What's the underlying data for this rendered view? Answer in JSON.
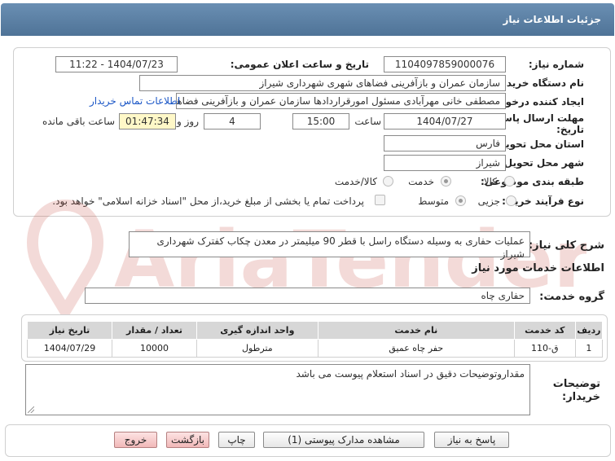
{
  "window": {
    "title": "جزئیات اطلاعات نیاز"
  },
  "need_number": {
    "label": "شماره نیاز:",
    "value": "1104097859000076"
  },
  "announce_date": {
    "label": "تاریخ و ساعت اعلان عمومی:",
    "value": "1404/07/23 - 11:22"
  },
  "buyer_org": {
    "label": "نام دستگاه خریدار:",
    "value": "سازمان عمران و بازآفرینی فضاهای شهری شهرداری شیراز"
  },
  "requester": {
    "label": "ایجاد کننده درخواست:",
    "value": "مصطفی خانی مهرآبادی مسئول امورقراردادها سازمان عمران و بازآفرینی فضاهای",
    "contact_link": "اطلاعات تماس خریدار"
  },
  "deadline": {
    "label_line1": "مهلت ارسال پاسخ: تا",
    "label_line2": "تاریخ:",
    "date": "1404/07/27",
    "time_label": "ساعت",
    "time": "15:00",
    "days": "4",
    "days_label": "روز و",
    "remaining": "01:47:34",
    "remaining_label": "ساعت باقی مانده"
  },
  "province": {
    "label": "استان محل تحویل:",
    "value": "فارس"
  },
  "city": {
    "label": "شهر محل تحویل:",
    "value": "شیراز"
  },
  "category": {
    "label": "طبقه بندی موضوعی:",
    "options": [
      "کالا",
      "خدمت",
      "کالا/خدمت"
    ],
    "selected": "خدمت"
  },
  "purchase_type": {
    "label": "نوع فرآیند خرید :",
    "options": [
      "جزیی",
      "متوسط"
    ],
    "selected": "متوسط",
    "payment_note": "پرداخت تمام یا بخشی از مبلغ خرید،از محل \"اسناد خزانه اسلامی\" خواهد بود."
  },
  "summary": {
    "label": "شرح کلی نیاز:",
    "value": "عملیات حفاری به وسیله دستگاه راسل با قطر 90 میلیمتر در معدن چکاب کفترک شهرداری شیراز"
  },
  "services": {
    "section_title": "اطلاعات خدمات مورد نیاز",
    "group_label": "گروه خدمت:",
    "group_value": "حفاری چاه",
    "columns": [
      "ردیف",
      "کد خدمت",
      "نام خدمت",
      "واحد اندازه گیری",
      "تعداد / مقدار",
      "تاریخ نیاز"
    ],
    "rows": [
      [
        "1",
        "ق-110",
        "حفر چاه عمیق",
        "مترطول",
        "10000",
        "1404/07/29"
      ]
    ]
  },
  "buyer_notes": {
    "label_line1": "توضیحات",
    "label_line2": "خریدار:",
    "value": "مقداروتوضیحات دقیق در اسناد استعلام پیوست می باشد"
  },
  "buttons": {
    "reply": "پاسخ به نیاز",
    "attachments": "مشاهده مدارک پیوستی (1)",
    "print": "چاپ",
    "back": "بازگشت",
    "exit": "خروج"
  },
  "watermark_text": "AriaTender.neT",
  "colors": {
    "titlebar": "#5b80a5",
    "link": "#1a56c6",
    "remaining_bg": "#fff8c8",
    "watermark": "#c0392b"
  }
}
